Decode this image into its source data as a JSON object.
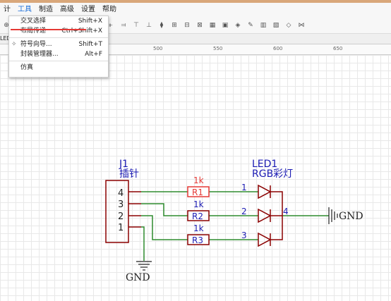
{
  "menu": {
    "items": [
      {
        "label": "计",
        "active": false
      },
      {
        "label": "工具",
        "active": true
      },
      {
        "label": "制造",
        "active": false
      },
      {
        "label": "高级",
        "active": false
      },
      {
        "label": "设置",
        "active": false
      },
      {
        "label": "帮助",
        "active": false
      }
    ]
  },
  "dropdown": {
    "items": [
      {
        "label": "交叉选择",
        "shortcut": "Shift+X"
      },
      {
        "label": "布局传递",
        "shortcut": "Ctrl+Shift+X"
      },
      {
        "label": "符号向导...",
        "shortcut": "Shift+T",
        "icon": "wand-icon"
      },
      {
        "label": "封装管理器...",
        "shortcut": "Alt+F"
      },
      {
        "label": "仿真",
        "shortcut": ""
      }
    ]
  },
  "tab": {
    "label": "LED"
  },
  "ruler": {
    "labels": [
      "500",
      "550",
      "600",
      "650"
    ]
  },
  "schematic": {
    "j1": {
      "ref": "J1",
      "name": "插针",
      "pins": [
        "4",
        "3",
        "2",
        "1"
      ]
    },
    "resistors": [
      {
        "ref": "R1",
        "value": "1k",
        "highlighted": true
      },
      {
        "ref": "R2",
        "value": "1k",
        "highlighted": false
      },
      {
        "ref": "R3",
        "value": "1k",
        "highlighted": false
      }
    ],
    "led": {
      "ref": "LED1",
      "name": "RGB彩灯",
      "pins": [
        "1",
        "2",
        "3",
        "4"
      ]
    },
    "gnd_right": "GND",
    "gnd_bottom": "GND"
  },
  "colors": {
    "wire": "#2e8b2e",
    "part": "#8b0000",
    "pin_label": "#1b1bb3",
    "highlight": "#e53935"
  }
}
